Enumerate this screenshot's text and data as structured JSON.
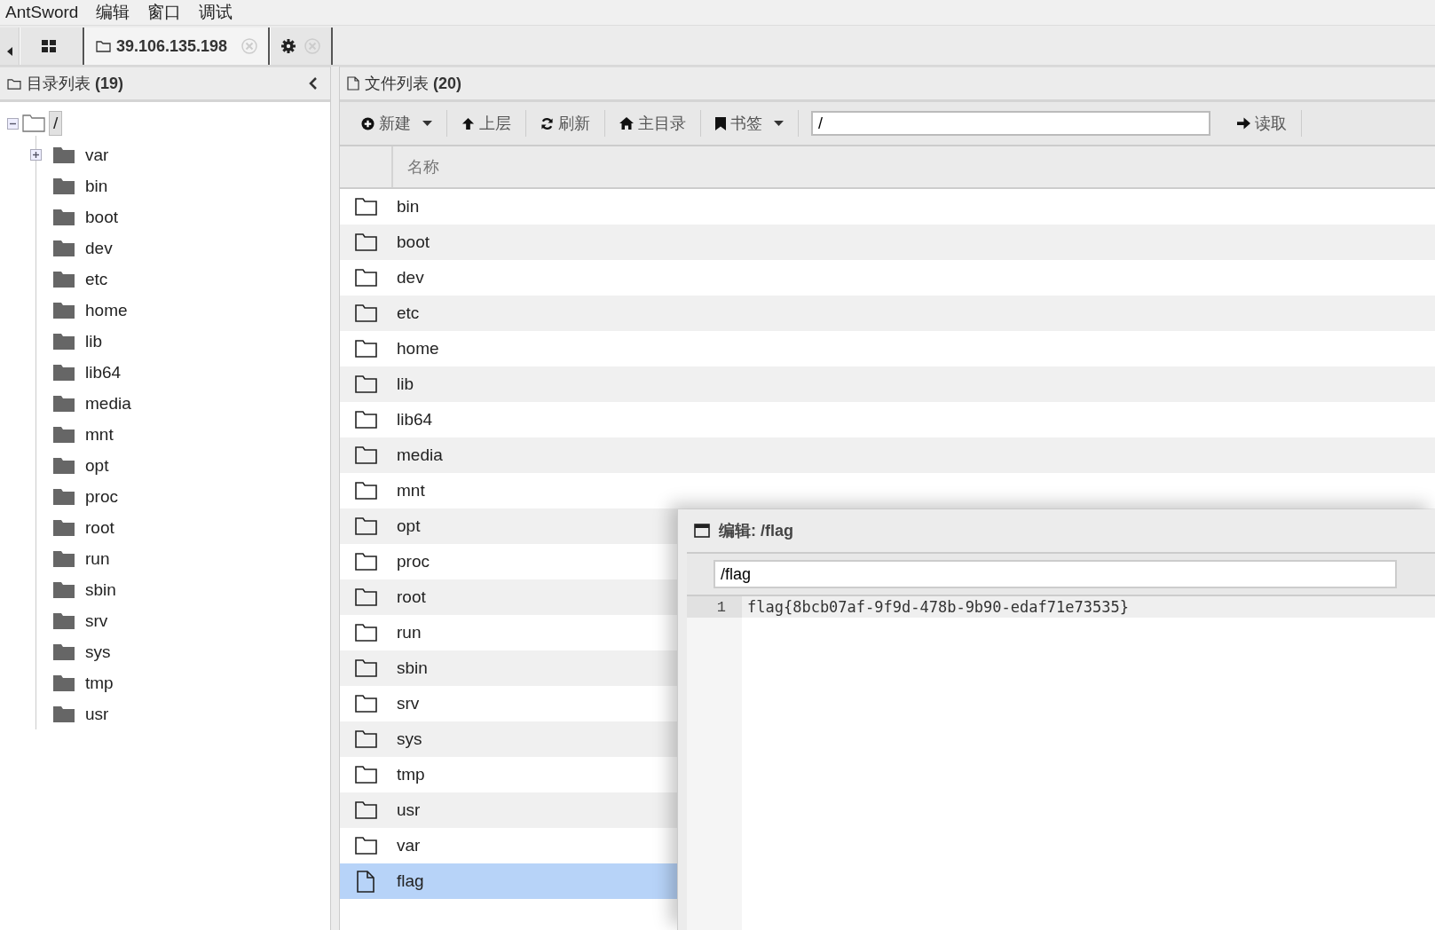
{
  "menu_bar": [
    "AntSword",
    "编辑",
    "窗口",
    "调试"
  ],
  "tabs": [
    {
      "kind": "home",
      "selected": false
    },
    {
      "kind": "connection",
      "label": "39.106.135.198",
      "selected": true
    },
    {
      "kind": "settings",
      "selected": false
    }
  ],
  "directory_panel": {
    "title": "目录列表",
    "count": "(19)",
    "tree": {
      "label": "/",
      "expanded": true,
      "selected": true,
      "children": [
        {
          "label": "var",
          "expanded": false,
          "selected": false
        },
        {
          "label": "bin",
          "selected": false
        },
        {
          "label": "boot",
          "selected": false
        },
        {
          "label": "dev",
          "selected": false
        },
        {
          "label": "etc",
          "selected": false
        },
        {
          "label": "home",
          "selected": false
        },
        {
          "label": "lib",
          "selected": false
        },
        {
          "label": "lib64",
          "selected": false
        },
        {
          "label": "media",
          "selected": false
        },
        {
          "label": "mnt",
          "selected": false
        },
        {
          "label": "opt",
          "selected": false
        },
        {
          "label": "proc",
          "selected": false
        },
        {
          "label": "root",
          "selected": false
        },
        {
          "label": "run",
          "selected": false
        },
        {
          "label": "sbin",
          "selected": false
        },
        {
          "label": "srv",
          "selected": false
        },
        {
          "label": "sys",
          "selected": false
        },
        {
          "label": "tmp",
          "selected": false
        },
        {
          "label": "usr",
          "selected": false
        }
      ]
    }
  },
  "file_panel": {
    "title": "文件列表",
    "count": "(20)",
    "toolbar": [
      {
        "kind": "button",
        "label": "新建",
        "dropdown": true
      },
      {
        "kind": "button",
        "label": "上层",
        "dropdown": false
      },
      {
        "kind": "button",
        "label": "刷新",
        "dropdown": false
      },
      {
        "kind": "button",
        "label": "主目录",
        "dropdown": false
      },
      {
        "kind": "button",
        "label": "书签",
        "dropdown": true
      },
      {
        "kind": "path",
        "value": "/"
      },
      {
        "kind": "button",
        "label": "读取",
        "dropdown": false
      }
    ],
    "columns": [
      "名称"
    ],
    "rows": [
      {
        "kind": "folder",
        "name": "bin",
        "selected": false
      },
      {
        "kind": "folder",
        "name": "boot",
        "selected": false
      },
      {
        "kind": "folder",
        "name": "dev",
        "selected": false
      },
      {
        "kind": "folder",
        "name": "etc",
        "selected": false
      },
      {
        "kind": "folder",
        "name": "home",
        "selected": false
      },
      {
        "kind": "folder",
        "name": "lib",
        "selected": false
      },
      {
        "kind": "folder",
        "name": "lib64",
        "selected": false
      },
      {
        "kind": "folder",
        "name": "media",
        "selected": false
      },
      {
        "kind": "folder",
        "name": "mnt",
        "selected": false
      },
      {
        "kind": "folder",
        "name": "opt",
        "selected": false
      },
      {
        "kind": "folder",
        "name": "proc",
        "selected": false
      },
      {
        "kind": "folder",
        "name": "root",
        "selected": false
      },
      {
        "kind": "folder",
        "name": "run",
        "selected": false
      },
      {
        "kind": "folder",
        "name": "sbin",
        "selected": false
      },
      {
        "kind": "folder",
        "name": "srv",
        "selected": false
      },
      {
        "kind": "folder",
        "name": "sys",
        "selected": false
      },
      {
        "kind": "folder",
        "name": "tmp",
        "selected": false
      },
      {
        "kind": "folder",
        "name": "usr",
        "selected": false
      },
      {
        "kind": "folder",
        "name": "var",
        "selected": false
      },
      {
        "kind": "file",
        "name": "flag",
        "selected": true
      }
    ]
  },
  "editor_window": {
    "title": "编辑: /flag",
    "path": "/flag",
    "lines": [
      {
        "number": "1",
        "text": "flag{8bcb07af-9f9d-478b-9b90-edaf71e73535}"
      }
    ]
  }
}
